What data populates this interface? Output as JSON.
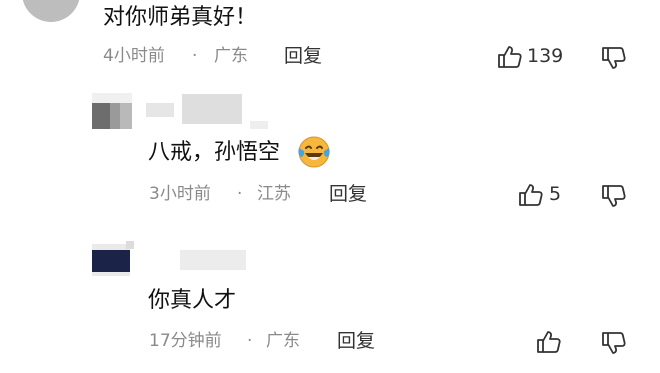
{
  "comments": [
    {
      "text": "对你师弟真好！",
      "time": "4小时前",
      "separator": "·",
      "location": "广东",
      "reply_label": "回复",
      "likes": "139"
    },
    {
      "text": "八戒，孙悟空",
      "emoji": "laughing-tears-emoji",
      "time": "3小时前",
      "separator": "·",
      "location": "江苏",
      "reply_label": "回复",
      "likes": "5"
    },
    {
      "text": "你真人才",
      "time": "17分钟前",
      "separator": "·",
      "location": "广东",
      "reply_label": "回复",
      "likes": ""
    }
  ],
  "icons": {
    "like": "thumbs-up-icon",
    "dislike": "thumbs-down-icon"
  },
  "colors": {
    "text": "#111111",
    "meta": "#8a8a8a",
    "emoji": "#f6b73c",
    "emoji_tears": "#4aa3df"
  }
}
